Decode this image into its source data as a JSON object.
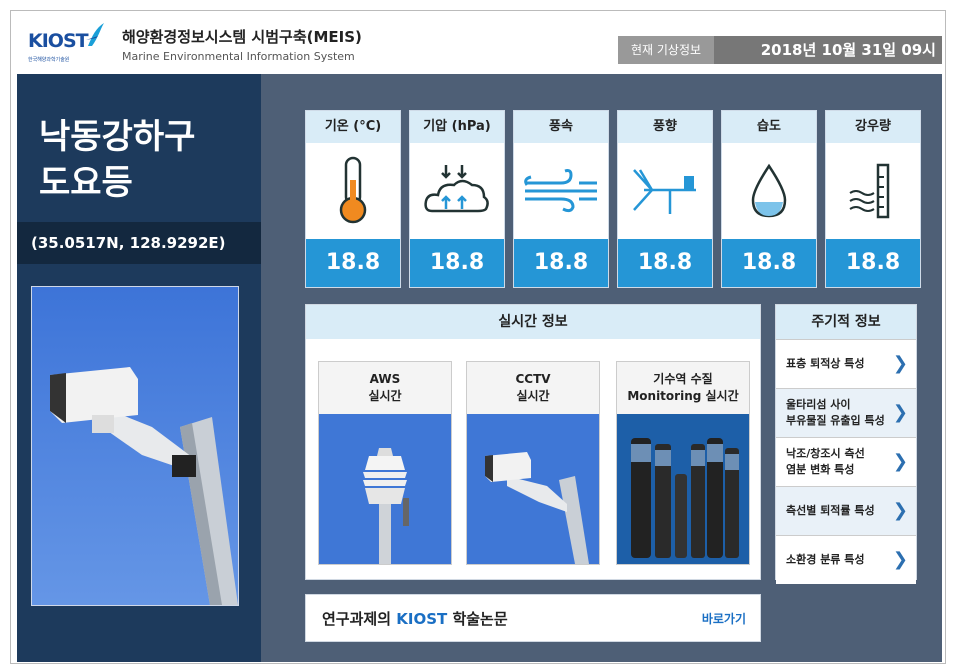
{
  "header": {
    "logo_text": "KIOST",
    "logo_sub": "한국해양과학기술원",
    "title_ko": "해양환경정보시스템 시범구축(MEIS)",
    "title_en": "Marine Environmental Information System",
    "weather_label": "현재 기상정보",
    "weather_datetime": "2018년 10월 31일 09시"
  },
  "station": {
    "name_line1": "낙동강하구",
    "name_line2": "도요등",
    "coords": "(35.0517N,  128.9292E)"
  },
  "weather": [
    {
      "label": "기온 (°C)",
      "value": "18.8",
      "icon": "thermometer-icon"
    },
    {
      "label": "기압 (hPa)",
      "value": "18.8",
      "icon": "pressure-cloud-icon"
    },
    {
      "label": "풍속",
      "value": "18.8",
      "icon": "wind-icon"
    },
    {
      "label": "풍향",
      "value": "18.8",
      "icon": "wind-vane-icon"
    },
    {
      "label": "습도",
      "value": "18.8",
      "icon": "water-drop-icon"
    },
    {
      "label": "강우량",
      "value": "18.8",
      "icon": "rain-gauge-icon"
    }
  ],
  "realtime": {
    "title": "실시간 정보",
    "cards": [
      {
        "line1": "AWS",
        "line2": "실시간"
      },
      {
        "line1": "CCTV",
        "line2": "실시간"
      },
      {
        "line1": "기수역 수질",
        "line2": "Monitoring 실시간"
      }
    ]
  },
  "periodic": {
    "title": "주기적 정보",
    "items": [
      {
        "line1": "표층 퇴적상 특성",
        "line2": ""
      },
      {
        "line1": "울타리섬 사이",
        "line2": "부유물질 유출입 특성"
      },
      {
        "line1": "낙조/창조시 측선",
        "line2": "염분 변화 특성"
      },
      {
        "line1": "측선별 퇴적률 특성",
        "line2": ""
      },
      {
        "line1": "소환경 분류 특성",
        "line2": ""
      }
    ]
  },
  "papers": {
    "prefix": "연구과제의 ",
    "highlight": "KIOST",
    "suffix": " 학술논문",
    "link": "바로가기"
  },
  "colors": {
    "left_panel": "#1d3a5c",
    "right_panel": "#4e5f76",
    "value_blue": "#2596d6",
    "header_tint": "#d9ecf7"
  }
}
